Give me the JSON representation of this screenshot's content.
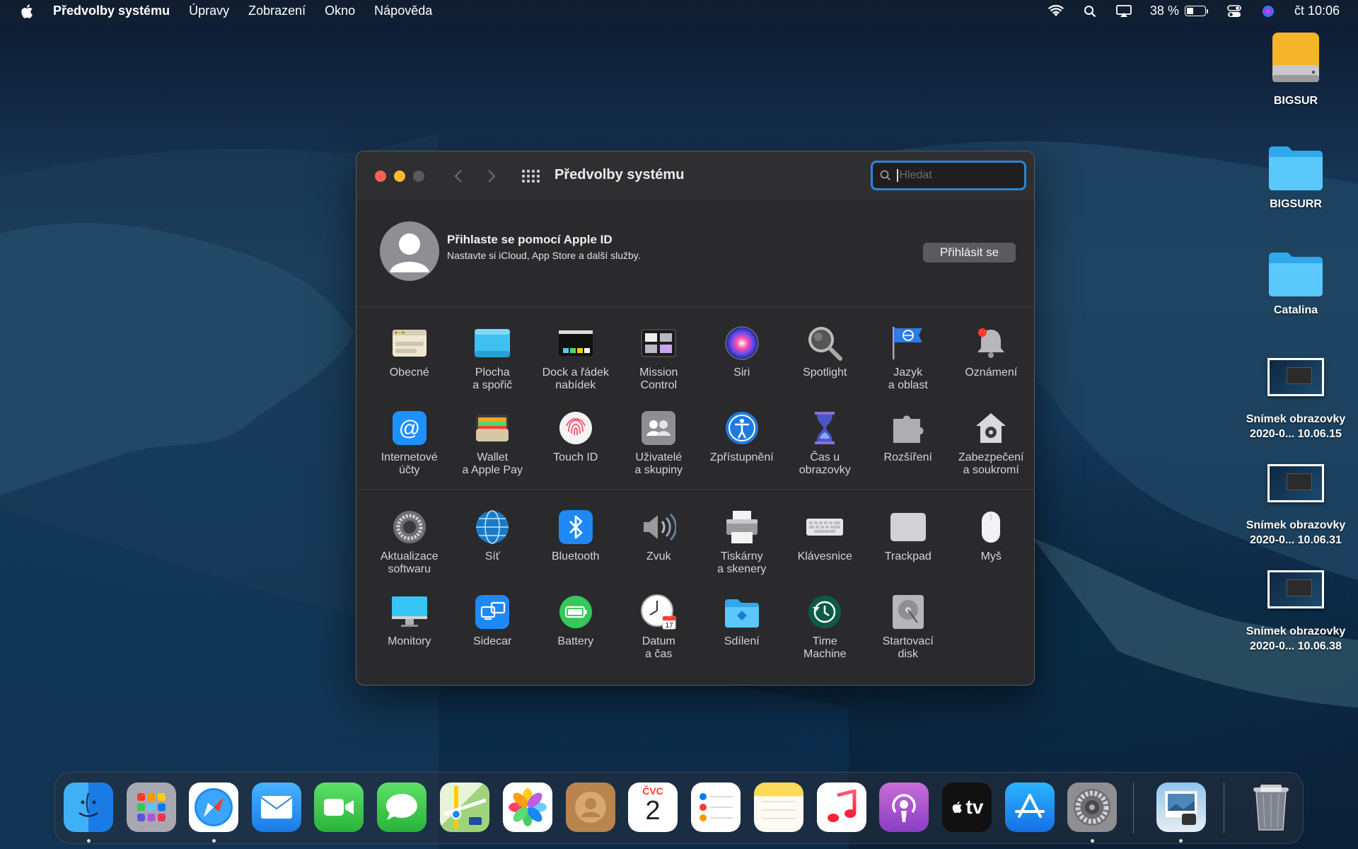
{
  "menubar": {
    "app_name": "Předvolby systému",
    "items": [
      "Úpravy",
      "Zobrazení",
      "Okno",
      "Nápověda"
    ],
    "battery_percent": "38 %",
    "battery_level": 0.38,
    "clock": "čt 10:06",
    "icons": [
      "apple-logo",
      "wifi-icon",
      "spotlight-search-icon",
      "airplay-icon",
      "battery-icon",
      "control-center-icon",
      "siri-icon"
    ]
  },
  "desktop": {
    "items": [
      {
        "label": "BIGSUR",
        "icon": "hard-drive-icon"
      },
      {
        "label": "BIGSURR",
        "icon": "folder-icon"
      },
      {
        "label": "Catalina",
        "icon": "folder-icon"
      },
      {
        "label": "Snímek obrazovky\n2020-0... 10.06.15",
        "icon": "screenshot-thumbnail"
      },
      {
        "label": "Snímek obrazovky\n2020-0... 10.06.31",
        "icon": "screenshot-thumbnail"
      },
      {
        "label": "Snímek obrazovky\n2020-0... 10.06.38",
        "icon": "screenshot-thumbnail"
      }
    ]
  },
  "window": {
    "title": "Předvolby systému",
    "search_placeholder": "Hledat",
    "apple_id": {
      "title": "Přihlaste se pomocí Apple ID",
      "subtitle": "Nastavte si iCloud, App Store a další služby.",
      "button": "Přihlásit se"
    },
    "section1": [
      {
        "label": "Obecné",
        "icon": "general-icon"
      },
      {
        "label": "Plocha\na spořič",
        "icon": "desktop-screensaver-icon"
      },
      {
        "label": "Dock a řádek\nnabídek",
        "icon": "dock-menubar-icon"
      },
      {
        "label": "Mission\nControl",
        "icon": "mission-control-icon"
      },
      {
        "label": "Siri",
        "icon": "siri-icon"
      },
      {
        "label": "Spotlight",
        "icon": "spotlight-icon"
      },
      {
        "label": "Jazyk\na oblast",
        "icon": "language-region-icon"
      },
      {
        "label": "Oznámení",
        "icon": "notifications-icon"
      },
      {
        "label": "Internetové\núčty",
        "icon": "internet-accounts-icon"
      },
      {
        "label": "Wallet\na Apple Pay",
        "icon": "wallet-icon"
      },
      {
        "label": "Touch ID",
        "icon": "touch-id-icon"
      },
      {
        "label": "Uživatelé\na skupiny",
        "icon": "users-groups-icon"
      },
      {
        "label": "Zpřístupnění",
        "icon": "accessibility-icon"
      },
      {
        "label": "Čas u obrazovky",
        "icon": "screen-time-icon"
      },
      {
        "label": "Rozšíření",
        "icon": "extensions-icon"
      },
      {
        "label": "Zabezpečení\na soukromí",
        "icon": "security-privacy-icon"
      }
    ],
    "section2": [
      {
        "label": "Aktualizace\nsoftwaru",
        "icon": "software-update-icon"
      },
      {
        "label": "Síť",
        "icon": "network-icon"
      },
      {
        "label": "Bluetooth",
        "icon": "bluetooth-icon"
      },
      {
        "label": "Zvuk",
        "icon": "sound-icon"
      },
      {
        "label": "Tiskárny\na skenery",
        "icon": "printers-scanners-icon"
      },
      {
        "label": "Klávesnice",
        "icon": "keyboard-icon"
      },
      {
        "label": "Trackpad",
        "icon": "trackpad-icon"
      },
      {
        "label": "Myš",
        "icon": "mouse-icon"
      },
      {
        "label": "Monitory",
        "icon": "displays-icon"
      },
      {
        "label": "Sidecar",
        "icon": "sidecar-icon"
      },
      {
        "label": "Battery",
        "icon": "battery-pref-icon"
      },
      {
        "label": "Datum\na čas",
        "icon": "date-time-icon"
      },
      {
        "label": "Sdílení",
        "icon": "sharing-icon"
      },
      {
        "label": "Time\nMachine",
        "icon": "time-machine-icon"
      },
      {
        "label": "Startovací\ndisk",
        "icon": "startup-disk-icon"
      }
    ]
  },
  "dock": {
    "calendar_month": "ČVC",
    "calendar_day": "2",
    "tv_label": "tv",
    "apps": [
      "finder-icon",
      "launchpad-icon",
      "safari-icon",
      "mail-icon",
      "facetime-icon",
      "messages-icon",
      "maps-icon",
      "photos-icon",
      "contacts-icon",
      "calendar-icon",
      "reminders-icon",
      "notes-icon",
      "music-icon",
      "podcasts-icon",
      "apple-tv-icon",
      "app-store-icon",
      "system-preferences-icon",
      "preview-icon",
      "trash-icon"
    ]
  }
}
